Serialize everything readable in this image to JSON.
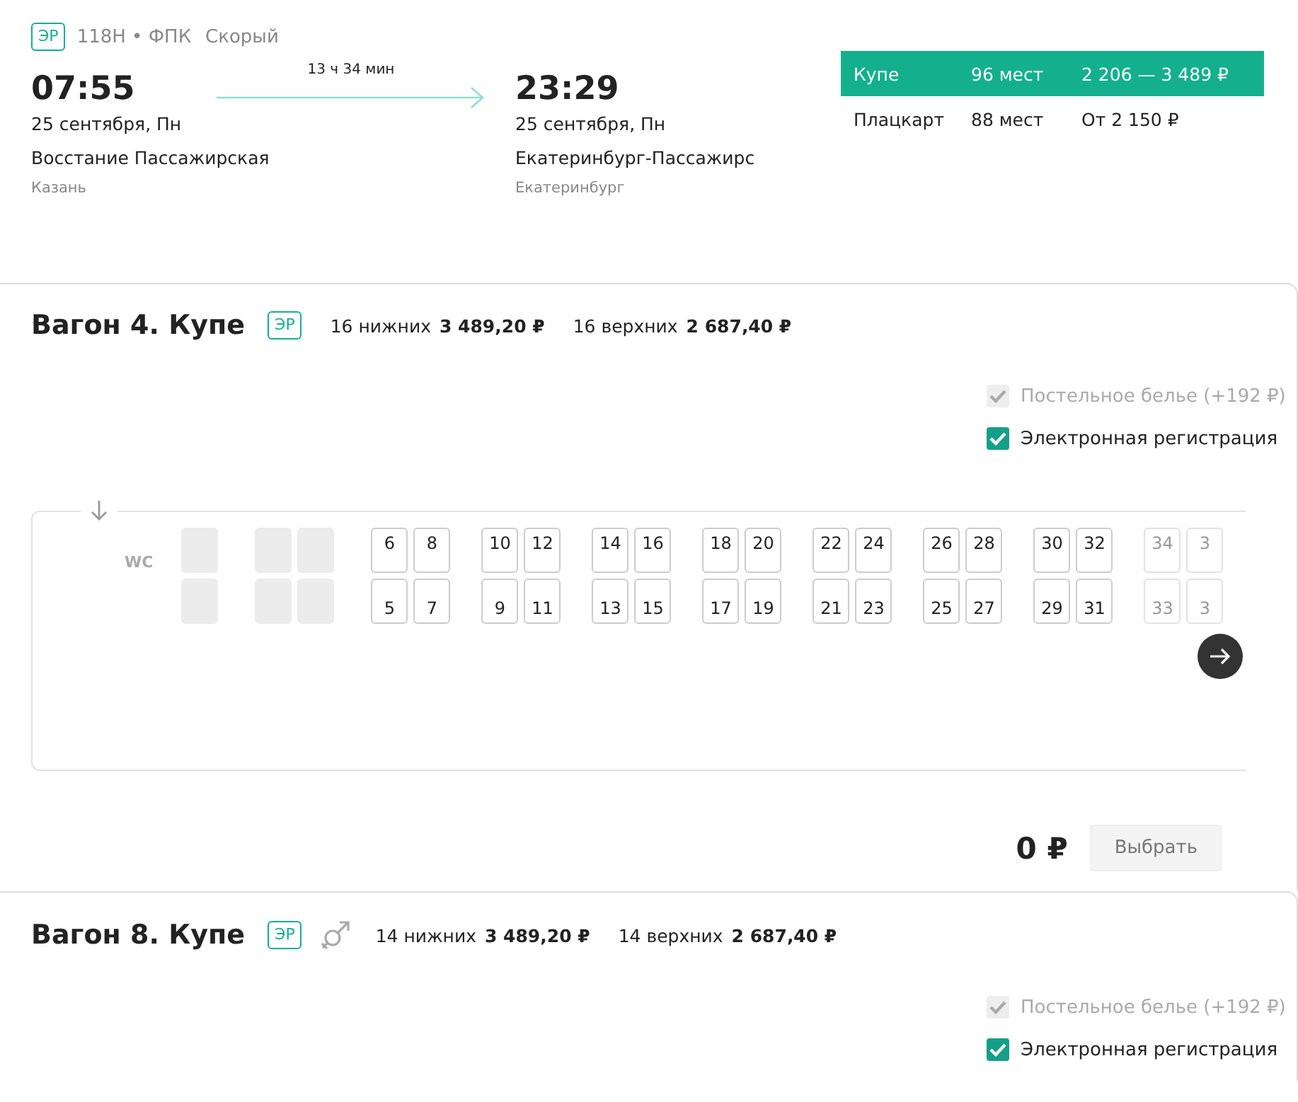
{
  "train": {
    "badge": "ЭР",
    "number": "118Н • ФПК",
    "type": "Скорый",
    "departure": {
      "time": "07:55",
      "date": "25 сентября, Пн",
      "station": "Восстание Пассажирская",
      "city": "Казань"
    },
    "duration": "13 ч 34 мин",
    "arrival": {
      "time": "23:29",
      "date": "25 сентября, Пн",
      "station": "Екатеринбург-Пассажирс",
      "city": "Екатеринбург"
    },
    "classes": [
      {
        "name": "Купе",
        "seats": "96 мест",
        "price": "2 206 — 3 489 ₽",
        "selected": true
      },
      {
        "name": "Плацкарт",
        "seats": "88 мест",
        "price": "От 2 150 ₽",
        "selected": false
      }
    ]
  },
  "wagons": [
    {
      "title": "Вагон 4. Купе",
      "badge": "ЭР",
      "mixed_gender": false,
      "lower_count": "16 нижних",
      "lower_price": "3 489,20 ₽",
      "upper_count": "16 верхних",
      "upper_price": "2 687,40 ₽",
      "options": [
        {
          "label": "Постельное белье (+192 ₽)",
          "checked": true,
          "disabled": true
        },
        {
          "label": "Электронная регистрация",
          "checked": true,
          "disabled": false
        }
      ],
      "seat_map": {
        "wc": "WC",
        "compartments": [
          {
            "top": [
              {
                "n": "6",
                "dim": false
              },
              {
                "n": "8",
                "dim": false
              }
            ],
            "bottom": [
              {
                "n": "5",
                "dim": false
              },
              {
                "n": "7",
                "dim": false
              }
            ]
          },
          {
            "top": [
              {
                "n": "10",
                "dim": false
              },
              {
                "n": "12",
                "dim": false
              }
            ],
            "bottom": [
              {
                "n": "9",
                "dim": false
              },
              {
                "n": "11",
                "dim": false
              }
            ]
          },
          {
            "top": [
              {
                "n": "14",
                "dim": false
              },
              {
                "n": "16",
                "dim": false
              }
            ],
            "bottom": [
              {
                "n": "13",
                "dim": false
              },
              {
                "n": "15",
                "dim": false
              }
            ]
          },
          {
            "top": [
              {
                "n": "18",
                "dim": false
              },
              {
                "n": "20",
                "dim": false
              }
            ],
            "bottom": [
              {
                "n": "17",
                "dim": false
              },
              {
                "n": "19",
                "dim": false
              }
            ]
          },
          {
            "top": [
              {
                "n": "22",
                "dim": false
              },
              {
                "n": "24",
                "dim": false
              }
            ],
            "bottom": [
              {
                "n": "21",
                "dim": false
              },
              {
                "n": "23",
                "dim": false
              }
            ]
          },
          {
            "top": [
              {
                "n": "26",
                "dim": false
              },
              {
                "n": "28",
                "dim": false
              }
            ],
            "bottom": [
              {
                "n": "25",
                "dim": false
              },
              {
                "n": "27",
                "dim": false
              }
            ]
          },
          {
            "top": [
              {
                "n": "30",
                "dim": false
              },
              {
                "n": "32",
                "dim": false
              }
            ],
            "bottom": [
              {
                "n": "29",
                "dim": false
              },
              {
                "n": "31",
                "dim": false
              }
            ]
          },
          {
            "top": [
              {
                "n": "34",
                "dim": true
              },
              {
                "n": "3",
                "dim": true
              }
            ],
            "bottom": [
              {
                "n": "33",
                "dim": true
              },
              {
                "n": "3",
                "dim": true
              }
            ]
          }
        ]
      },
      "total": "0 ₽",
      "button": "Выбрать"
    },
    {
      "title": "Вагон 8. Купе",
      "badge": "ЭР",
      "mixed_gender": true,
      "lower_count": "14 нижних",
      "lower_price": "3 489,20 ₽",
      "upper_count": "14 верхних",
      "upper_price": "2 687,40 ₽",
      "options": [
        {
          "label": "Постельное белье (+192 ₽)",
          "checked": true,
          "disabled": true
        },
        {
          "label": "Электронная регистрация",
          "checked": true,
          "disabled": false
        }
      ]
    }
  ]
}
